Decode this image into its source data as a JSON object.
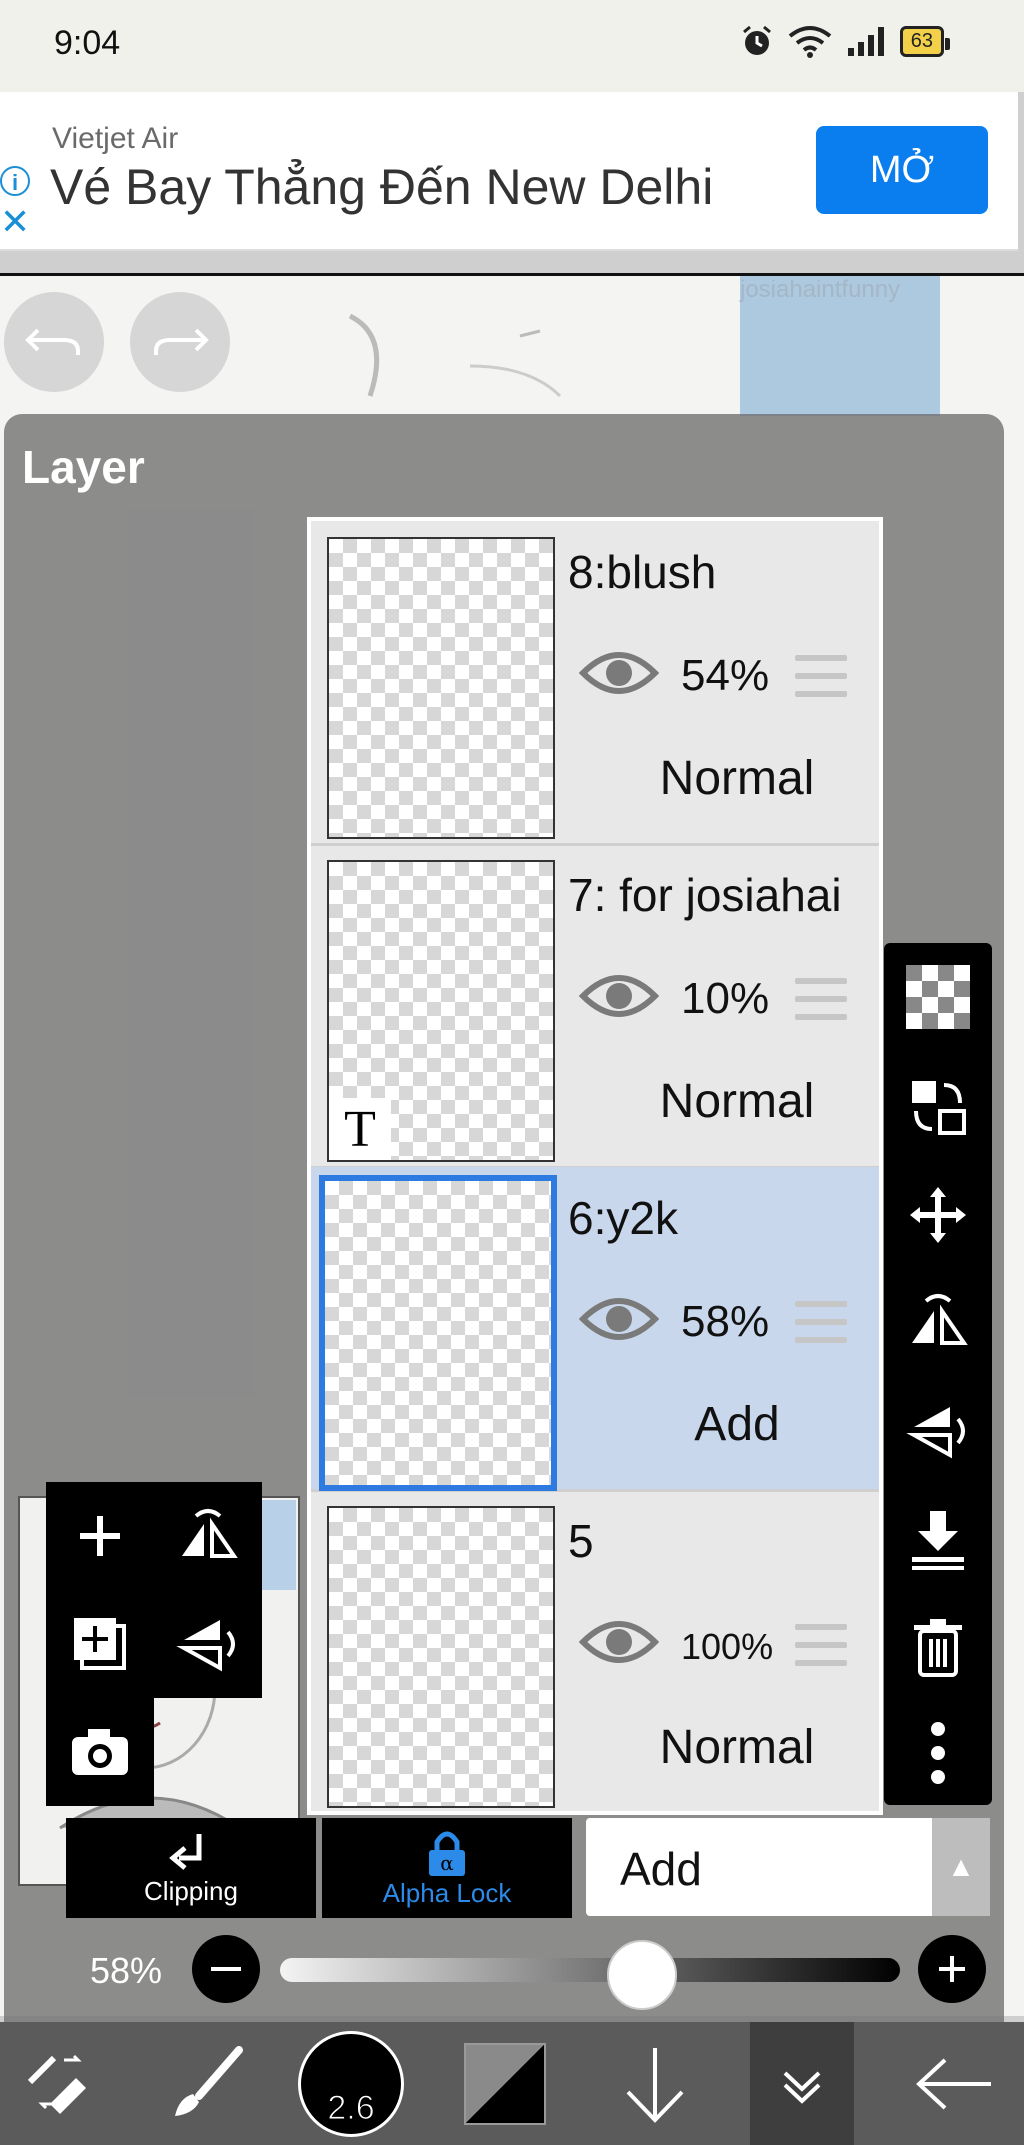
{
  "status_bar": {
    "time": "9:04",
    "battery": "63"
  },
  "ad": {
    "brand": "Vietjet Air",
    "title": "Vé Bay Thẳng Đến New Delhi",
    "cta": "MỞ"
  },
  "canvas": {
    "reference_text": "josiahaintfunny"
  },
  "layer_panel": {
    "title": "Layer",
    "layers": [
      {
        "name": "8:blush",
        "opacity": "54%",
        "blend": "Normal",
        "selected": false,
        "text_layer": false
      },
      {
        "name": "7: for josiahai",
        "opacity": "10%",
        "blend": "Normal",
        "selected": false,
        "text_layer": true
      },
      {
        "name": "6:y2k",
        "opacity": "58%",
        "blend": "Add",
        "selected": true,
        "text_layer": false
      },
      {
        "name": "5",
        "opacity": "100%",
        "blend": "Normal",
        "selected": false,
        "text_layer": false
      }
    ],
    "text_badge": "T"
  },
  "controls": {
    "clipping_label": "Clipping",
    "alpha_lock_label": "Alpha Lock",
    "blend_mode": "Add",
    "opacity_label": "58%",
    "opacity_value": 0.58
  },
  "bottom_bar": {
    "brush_size": "2.6"
  },
  "colors": {
    "accent": "#2d7be0",
    "ad_button": "#0a7eef",
    "selected_row": "#c9d7ec"
  }
}
